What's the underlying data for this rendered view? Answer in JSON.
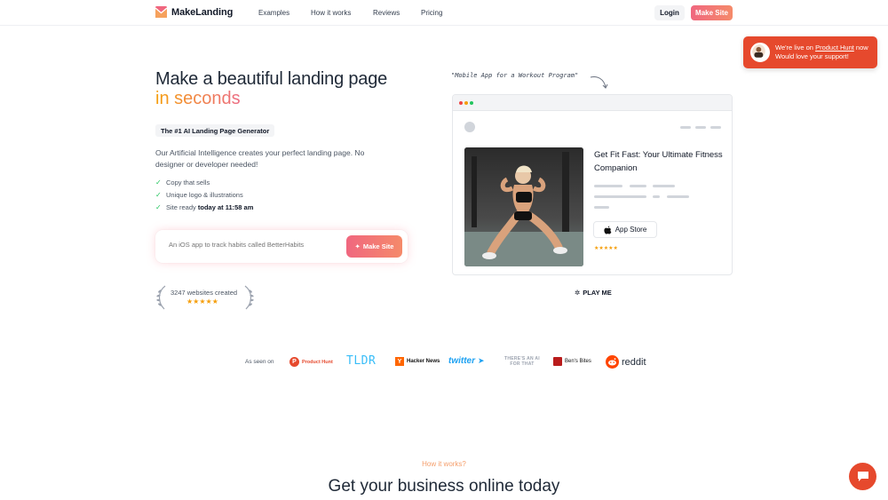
{
  "nav": {
    "brand": "MakeLanding",
    "links": [
      "Examples",
      "How it works",
      "Reviews",
      "Pricing"
    ],
    "login_label": "Login",
    "cta_label": "Make Site"
  },
  "ph_banner": {
    "line1_prefix": "We're live on ",
    "line1_link": "Product Hunt",
    "line1_suffix": " now",
    "line2": "Would love your support!"
  },
  "hero": {
    "title_line1": "Make a beautiful landing page",
    "title_line2": "in seconds",
    "badge": "The #1 AI Landing Page Generator",
    "description": "Our Artificial Intelligence creates your perfect landing page. No designer or developer needed!",
    "checks": [
      {
        "text": "Copy that sells",
        "bold": ""
      },
      {
        "text": "Unique logo & illustrations",
        "bold": ""
      },
      {
        "text": "Site ready ",
        "bold": "today at 11:58 am"
      }
    ],
    "prompt_placeholder": "An iOS app to track habits called BetterHabits",
    "prompt_button": "Make Site",
    "websites_created": "3247 websites created",
    "stars": "★★★★★"
  },
  "preview": {
    "caption": "\"Mobile App for a Workout Program\"",
    "title": "Get Fit Fast: Your Ultimate Fitness Companion",
    "store_label": "App Store",
    "stars": "★★★★★",
    "play_label": "PLAY ME"
  },
  "seen_on": {
    "label": "As seen on",
    "brands": [
      "Product Hunt",
      "TLDR",
      "Hacker News",
      "twitter",
      "THERE'S AN AI FOR THAT",
      "Ben's Bites",
      "reddit"
    ]
  },
  "how": {
    "label": "How it works?",
    "title": "Get your business online today"
  },
  "colors": {
    "accent": "#f0677f",
    "accent2": "#f58a6a",
    "ph_red": "#e6492d",
    "check_green": "#22c55e",
    "star": "#f59e0b"
  }
}
